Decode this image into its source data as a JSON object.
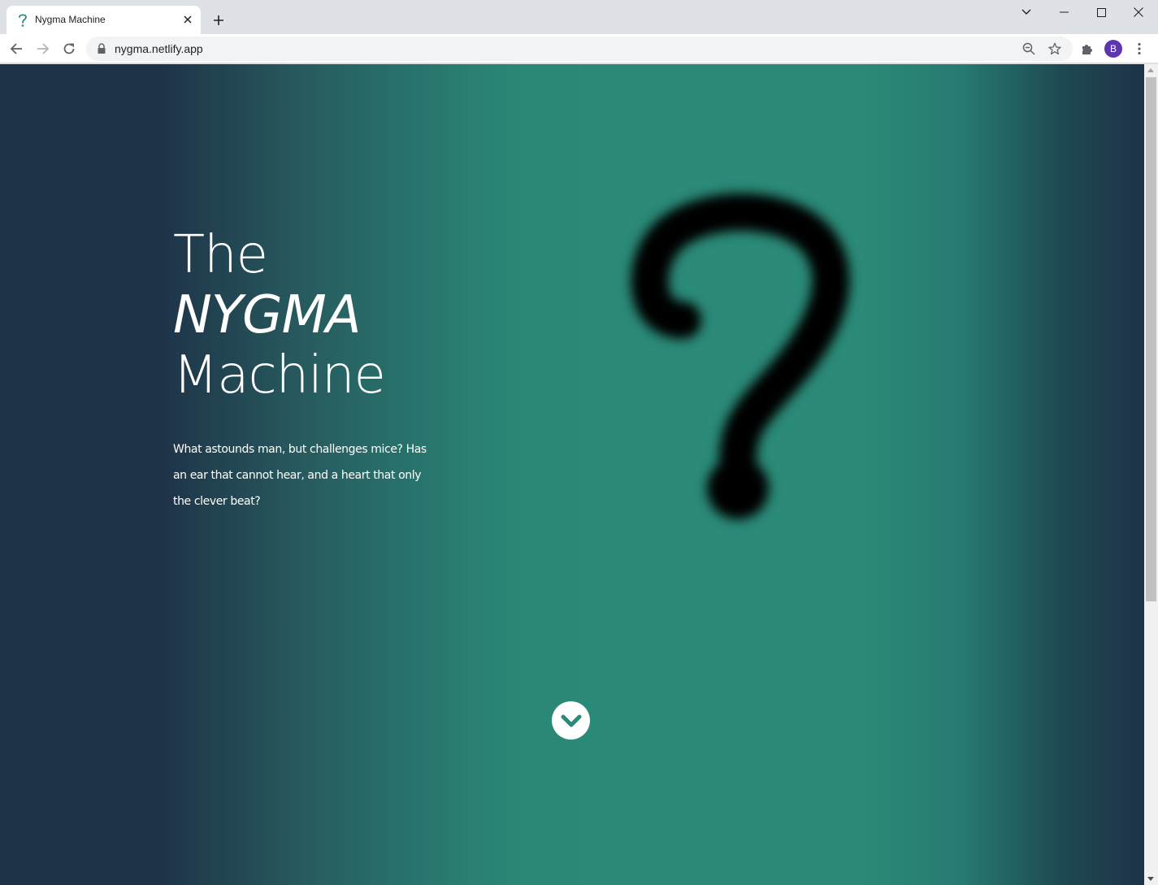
{
  "browser": {
    "tab_title": "Nygma Machine",
    "url": "nygma.netlify.app",
    "profile_initial": "B"
  },
  "hero": {
    "title_line1": "The",
    "title_line2": "NYGMA",
    "title_line3": "Machine",
    "description": "What astounds man, but challenges mice? Has an ear that cannot hear, and a heart that only the clever beat?"
  },
  "colors": {
    "gradient_edge": "#1e3348",
    "gradient_center": "#2b8a78",
    "avatar": "#5e35b1"
  },
  "icons": {
    "hero_graphic": "question-mark-icon",
    "scroll": "chevron-down-icon"
  }
}
